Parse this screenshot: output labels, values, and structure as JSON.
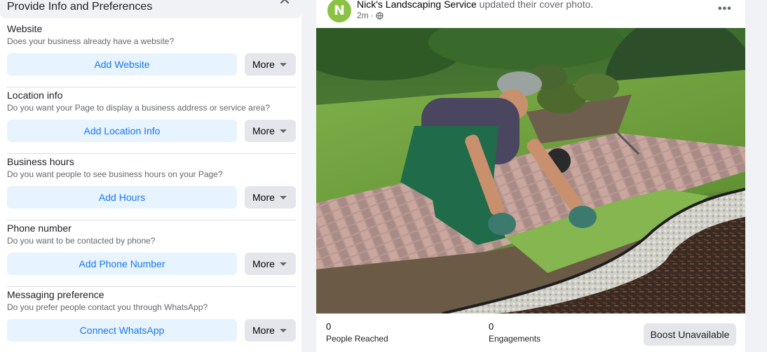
{
  "left_panel": {
    "title": "Provide Info and Preferences",
    "sections": [
      {
        "title": "Website",
        "description": "Does your business already have a website?",
        "action_label": "Add Website",
        "more_label": "More"
      },
      {
        "title": "Location info",
        "description": "Do you want your Page to display a business address or service area?",
        "action_label": "Add Location Info",
        "more_label": "More"
      },
      {
        "title": "Business hours",
        "description": "Do you want people to see business hours on your Page?",
        "action_label": "Add Hours",
        "more_label": "More"
      },
      {
        "title": "Phone number",
        "description": "Do you want to be contacted by phone?",
        "action_label": "Add Phone Number",
        "more_label": "More"
      },
      {
        "title": "Messaging preference",
        "description": "Do you prefer people contact you through WhatsApp?",
        "action_label": "Connect WhatsApp",
        "more_label": "More"
      }
    ]
  },
  "post": {
    "avatar_letter": "N",
    "author": "Nick's Landscaping Service",
    "action": "updated their cover photo.",
    "time": "2m",
    "audience_icon": "globe-icon",
    "options_icon": "more-options-icon",
    "stats": [
      {
        "value": "0",
        "label": "People Reached"
      },
      {
        "value": "0",
        "label": "Engagements"
      }
    ],
    "boost_label": "Boost Unavailable"
  },
  "colors": {
    "accent": "#1877f2",
    "accent_light": "#e7f3ff",
    "secondary_button": "#e4e6eb",
    "avatar_bg": "#8ac243",
    "page_bg": "#f0f2f5"
  }
}
